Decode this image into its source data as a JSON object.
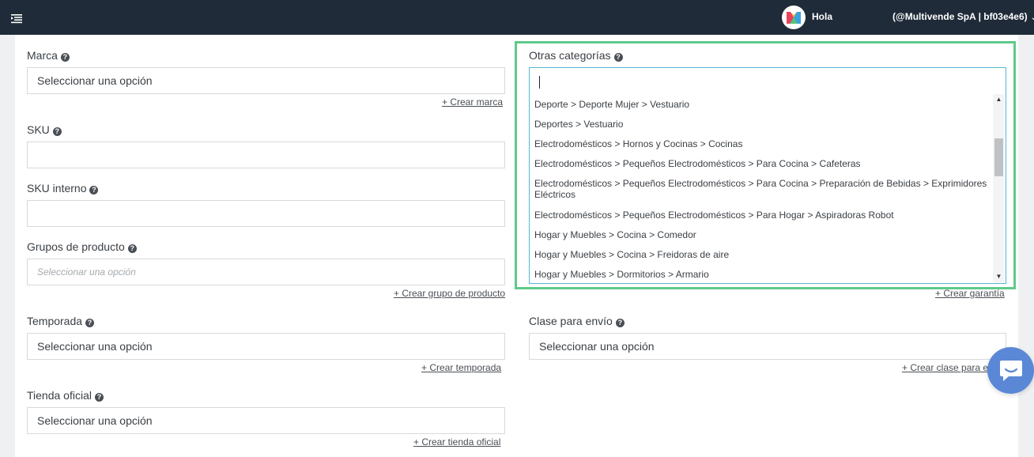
{
  "topbar": {
    "greeting": "Hola",
    "account": "(@Multivende SpA | bf03e4e6)"
  },
  "form": {
    "marca": {
      "label": "Marca",
      "value": "Seleccionar una opción",
      "create_link": "+ Crear marca"
    },
    "sku": {
      "label": "SKU",
      "value": ""
    },
    "sku_interno": {
      "label": "SKU interno",
      "value": ""
    },
    "grupos": {
      "label": "Grupos de producto",
      "placeholder": "Seleccionar una opción",
      "create_link": "+ Crear grupo de producto"
    },
    "temporada": {
      "label": "Temporada",
      "value": "Seleccionar una opción",
      "create_link": "+ Crear temporada"
    },
    "tienda": {
      "label": "Tienda oficial",
      "value": "Seleccionar una opción",
      "create_link": "+ Crear tienda oficial"
    },
    "otras_categorias": {
      "label": "Otras categorías",
      "search_value": "",
      "options": [
        "Deporte > Deporte Mujer > Vestuario",
        "Deportes > Vestuario",
        "Electrodomésticos > Hornos y Cocinas > Cocinas",
        "Electrodomésticos > Pequeños Electrodomésticos > Para Cocina > Cafeteras",
        "Electrodomésticos > Pequeños Electrodomésticos > Para Cocina > Preparación de Bebidas > Exprimidores Eléctricos",
        "Electrodomésticos > Pequeños Electrodomésticos > Para Hogar > Aspiradoras Robot",
        "Hogar y Muebles > Cocina > Comedor",
        "Hogar y Muebles > Cocina > Freidoras de aire",
        "Hogar y Muebles > Dormitorios > Armario"
      ]
    },
    "garantia": {
      "create_link": "+ Crear garantía"
    },
    "clase_envio": {
      "label": "Clase para envío",
      "value": "Seleccionar una opción",
      "create_link": "+ Crear clase para en"
    }
  },
  "colors": {
    "topbar": "#1f2b38",
    "highlight": "#5fc98a",
    "focus_border": "#55b7cf",
    "chat": "#5b88d6"
  },
  "icons": [
    "menu-icon",
    "multivende-logo-icon",
    "chevron-down-icon",
    "help-icon",
    "chat-icon"
  ]
}
